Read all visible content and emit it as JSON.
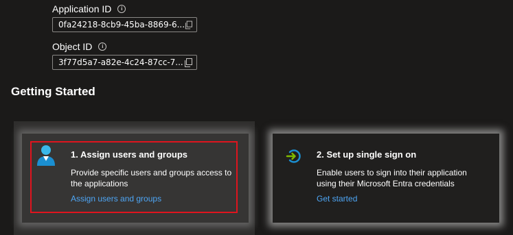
{
  "fields": {
    "application_id": {
      "label": "Application ID",
      "value": "0fa24218-8cb9-45ba-8869-6..."
    },
    "object_id": {
      "label": "Object ID",
      "value": "3f77d5a7-a82e-4c24-87cc-7..."
    }
  },
  "info_icon_glyph": "i",
  "section": {
    "title": "Getting Started"
  },
  "cards": [
    {
      "title": "1. Assign users and groups",
      "description": "Provide specific users and groups access to the applications",
      "link": "Assign users and groups",
      "icon": "user-icon"
    },
    {
      "title": "2. Set up single sign on",
      "description": "Enable users to sign into their application using their Microsoft Entra credentials",
      "link": "Get started",
      "icon": "sign-in-arrow-icon"
    }
  ],
  "colors": {
    "background": "#1b1a19",
    "link": "#4ea6f5",
    "highlight_border": "#e0141e"
  }
}
